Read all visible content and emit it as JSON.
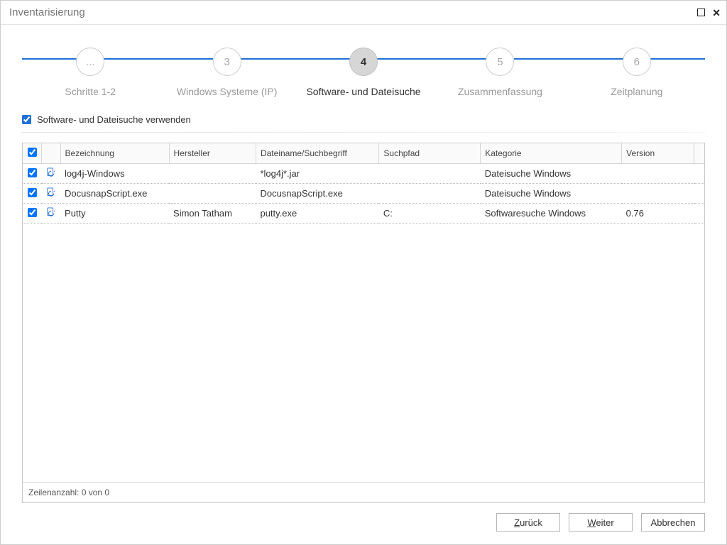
{
  "title": "Inventarisierung",
  "steps": [
    {
      "num": "...",
      "label": "Schritte 1-2"
    },
    {
      "num": "3",
      "label": "Windows Systeme (IP)"
    },
    {
      "num": "4",
      "label": "Software- und Dateisuche",
      "active": true
    },
    {
      "num": "5",
      "label": "Zusammenfassung"
    },
    {
      "num": "6",
      "label": "Zeitplanung"
    }
  ],
  "option_checkbox_label": "Software- und Dateisuche verwenden",
  "columns": {
    "name": "Bezeichnung",
    "manufacturer": "Hersteller",
    "filename": "Dateiname/Suchbegriff",
    "searchpath": "Suchpfad",
    "category": "Kategorie",
    "version": "Version"
  },
  "rows": [
    {
      "checked": true,
      "name": "log4j-Windows",
      "manufacturer": "",
      "filename": "*log4j*.jar",
      "searchpath": "",
      "category": "Dateisuche Windows",
      "version": ""
    },
    {
      "checked": true,
      "name": "DocusnapScript.exe",
      "manufacturer": "",
      "filename": "DocusnapScript.exe",
      "searchpath": "",
      "category": "Dateisuche Windows",
      "version": ""
    },
    {
      "checked": true,
      "name": "Putty",
      "manufacturer": "Simon Tatham",
      "filename": "putty.exe",
      "searchpath": "C:",
      "category": "Softwaresuche Windows",
      "version": "0.76"
    }
  ],
  "footer_text": "Zeilenanzahl: 0 von 0",
  "buttons": {
    "back": "Zurück",
    "next": "Weiter",
    "cancel": "Abbrechen"
  }
}
